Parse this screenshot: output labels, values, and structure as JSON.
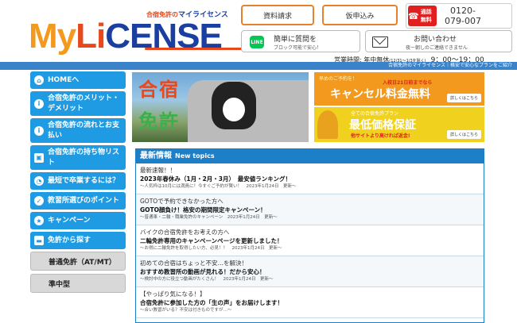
{
  "header": {
    "logo_tagline_prefix": "合宿免許の",
    "logo_tagline_brand": "マイライセンス",
    "logo_my": "My",
    "logo_li": "Li",
    "logo_cense": "CENSE",
    "btn_shiryo": "資料請求",
    "btn_kari": "仮申込み",
    "tel_badge": "通話無料",
    "tel_number_line1": "0120-",
    "tel_number_line2": "079-007",
    "line_main": "簡単に質問を",
    "line_sub": "ブロック可能で安心！",
    "mail_main": "お問い合わせ",
    "mail_sub": "夜ー朝しのご連絡できません",
    "hours_label": "営業時間: 年中無休",
    "hours_note": "(12/31〜1/3を除く)",
    "hours_time": "9：00〜19：00",
    "bar_text": "合宿免許のマイライセンス｜格安で安心なプランをご紹介"
  },
  "sidebar": {
    "items": [
      {
        "label": "HOMEへ",
        "icon": "home-icon",
        "glyph": "⌂"
      },
      {
        "label": "合宿免許のメリット・デメリット",
        "icon": "info-icon",
        "glyph": "i"
      },
      {
        "label": "合宿免許の流れとお支払い",
        "icon": "info-icon",
        "glyph": "i"
      },
      {
        "label": "合宿免許の持ち物リスト",
        "icon": "bag-icon",
        "glyph": "▣"
      },
      {
        "label": "最短で卒業するには？",
        "icon": "clock-icon",
        "glyph": "◔"
      },
      {
        "label": "教習所選びのポイント",
        "icon": "check-icon",
        "glyph": "✓"
      },
      {
        "label": "キャンペーン",
        "icon": "star-icon",
        "glyph": "★"
      },
      {
        "label": "免許から探す",
        "icon": "car-icon",
        "glyph": "▬"
      }
    ],
    "sub_items": [
      {
        "label": "普通免許（AT/MT）"
      },
      {
        "label": "準中型"
      }
    ]
  },
  "hero": {
    "line1": "合宿",
    "line2": "免許"
  },
  "banner1": {
    "sub": "早めのご予約を！",
    "note": "入校日21日前までなら",
    "title": "キャンセル料金無料",
    "detail": "詳しくはこちら"
  },
  "banner2": {
    "sub": "全ての合宿免許プラン",
    "title": "最低価格保証",
    "red": "他サイトより高ければ返金!",
    "detail": "詳しくはこちら"
  },
  "news": {
    "title": "最新情報",
    "title_en": "New topics",
    "items": [
      {
        "line1": "最新速報！！",
        "line2": "2023年春休み（1月・2月・3月）　最安値ランキング！",
        "line3": "〜人気枠は10月には満員に！今すぐご予約が賢い！　2023年1月24日　更新〜"
      },
      {
        "line1": "GOTOで予約できなかった方へ",
        "line2": "GOTO顔負け！格安の期間限定キャンペーン！",
        "line3": "〜普通車・二輪・職業免許のキャンペーン　2023年1月24日　更新〜"
      },
      {
        "line1": "バイクの合宿免許をお考えの方へ",
        "line2": "二輪免許専用のキャンペーンページを更新しました！",
        "line3": "〜お得に二輪免許を取得したい方、必見！！　2023年1月24日　更新〜"
      },
      {
        "line1": "初めての合宿はちょっと不安…を解決！",
        "line2": "おすすめ教習所の動画が見れる！だから安心！",
        "line3": "〜検討中の方に役立つ動画がたくさん！　2023年1月24日　更新〜"
      },
      {
        "line1": "【やっぱり気になる！】",
        "line2": "合宿免許に参加した方の「生の声」をお届けします！",
        "line3": "〜合い教習がいる？不安は付きものですが…〜"
      }
    ]
  }
}
